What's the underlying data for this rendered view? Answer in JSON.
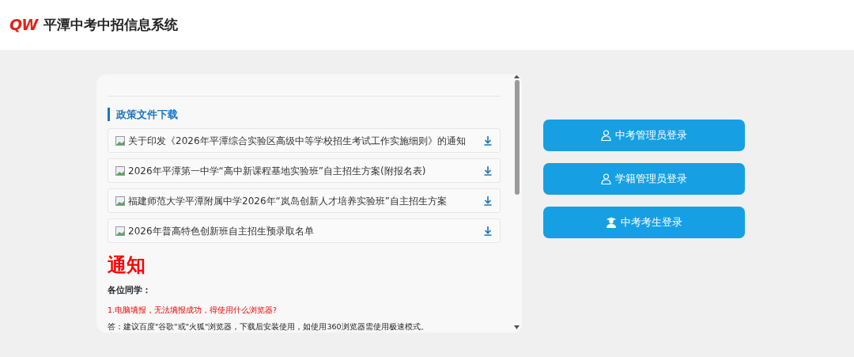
{
  "header": {
    "logo_text": "QW",
    "title": "平潭中考中招信息系统"
  },
  "policy": {
    "heading": "政策文件下载",
    "files": [
      {
        "title": "关于印发《2026年平潭综合实验区高级中等学校招生考试工作实施细则》的通知"
      },
      {
        "title": "2026年平潭第一中学“高中新课程基地实验班”自主招生方案(附报名表)"
      },
      {
        "title": "福建师范大学平潭附属中学2026年“岚岛创新人才培养实验班”自主招生方案"
      },
      {
        "title": "2026年普高特色创新班自主招生预录取名单"
      }
    ]
  },
  "notice": {
    "title": "通知",
    "greeting": "各位同学：",
    "paragraphs": [
      {
        "kind": "question",
        "text": "1.电脑填报，无法填报成功，得使用什么浏览器?"
      },
      {
        "kind": "answer",
        "text": "答：建议百度\"谷歌\"或\"火狐\"浏览器，下载后安装使用，如使用360浏览器需使用极速模式。"
      }
    ]
  },
  "logins": [
    {
      "kind": "admin",
      "label": "中考管理员登录"
    },
    {
      "kind": "admin",
      "label": "学籍管理员登录"
    },
    {
      "kind": "student",
      "label": "中考考生登录"
    }
  ]
}
